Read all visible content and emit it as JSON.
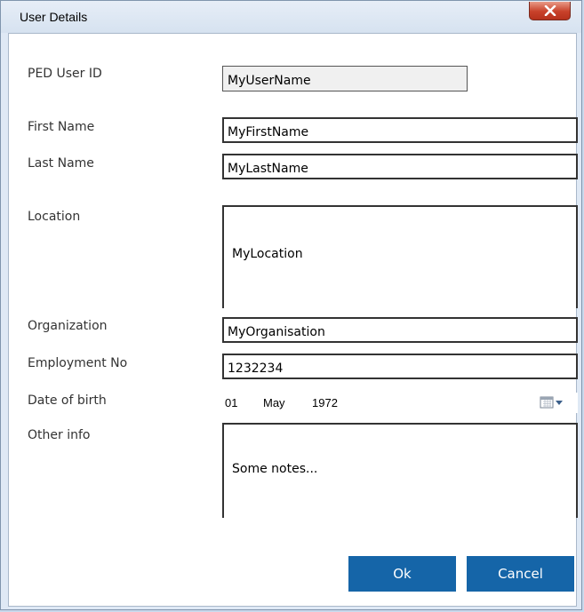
{
  "window": {
    "title": "User Details"
  },
  "form": {
    "ped_user_id": {
      "label": "PED User ID",
      "value": "MyUserName"
    },
    "first_name": {
      "label": "First Name",
      "value": "MyFirstName"
    },
    "last_name": {
      "label": "Last Name",
      "value": "MyLastName"
    },
    "location": {
      "label": "Location",
      "value": "MyLocation"
    },
    "organization": {
      "label": "Organization",
      "value": "MyOrganisation"
    },
    "employment_no": {
      "label": "Employment No",
      "value": "1232234"
    },
    "date_of_birth": {
      "label": "Date of birth",
      "day": "01",
      "month": "May",
      "year": "1972"
    },
    "other_info": {
      "label": "Other info",
      "value": "Some notes..."
    }
  },
  "buttons": {
    "ok": "Ok",
    "cancel": "Cancel"
  },
  "colors": {
    "button_bg": "#1565a8",
    "close_button_red": "#c8412a"
  },
  "icons": {
    "close": "close-icon",
    "calendar": "calendar-icon"
  }
}
